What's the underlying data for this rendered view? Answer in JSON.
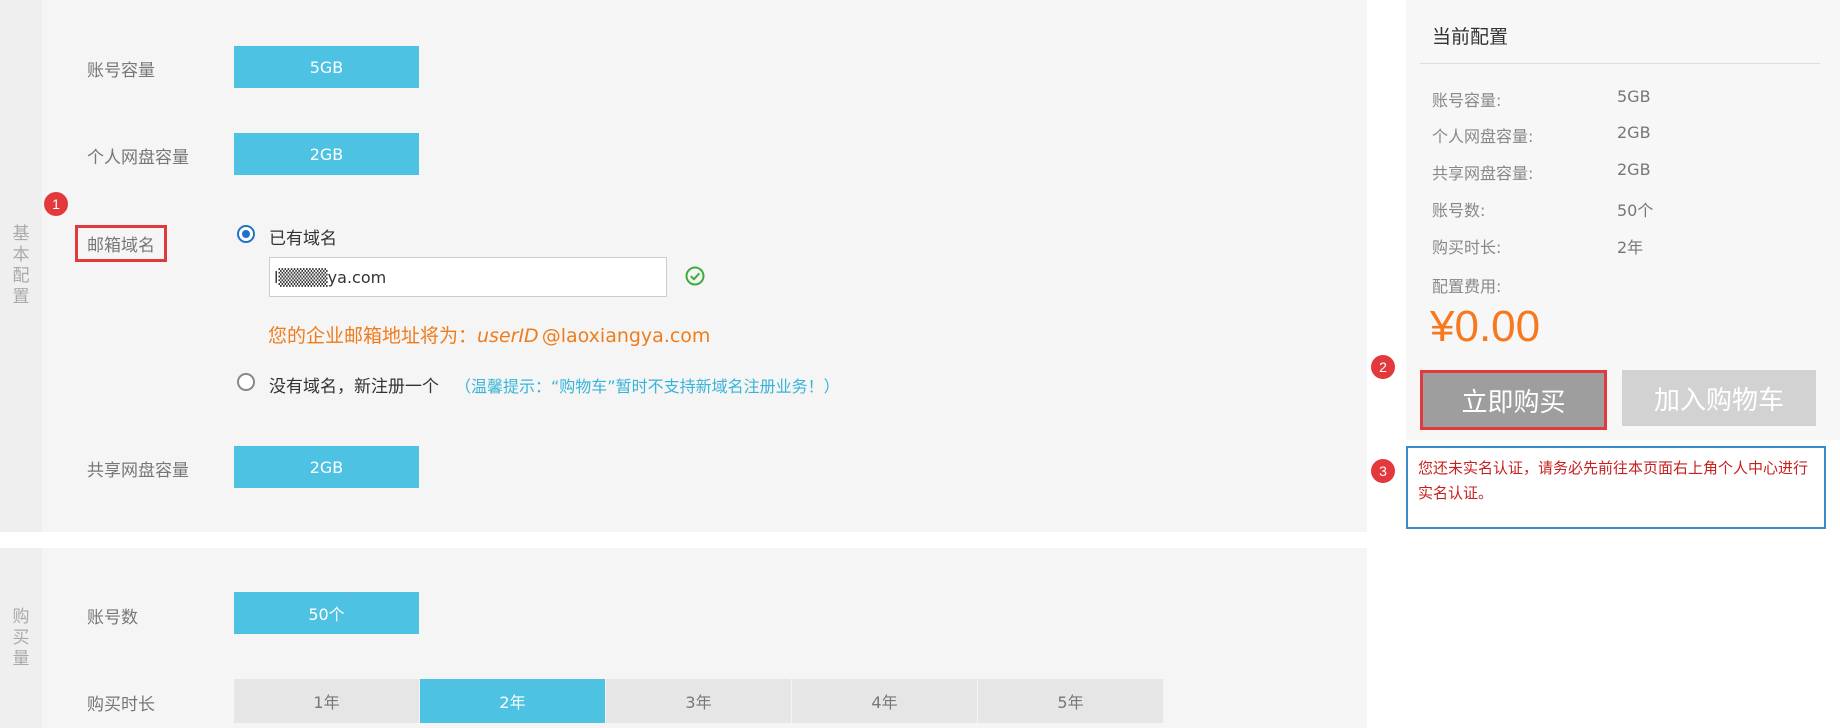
{
  "basic_panel": {
    "side_label": [
      "基",
      "本",
      "配",
      "置"
    ],
    "account_capacity": {
      "label": "账号容量",
      "value": "5GB"
    },
    "personal_disk": {
      "label": "个人网盘容量",
      "value": "2GB"
    },
    "mail_domain": {
      "label": "邮箱域名",
      "badge": "1",
      "option_existing": "已有域名",
      "domain_value": "l▒▒▒▒ya.com",
      "address_prefix": "您的企业邮箱地址将为：",
      "address_user": "userID",
      "address_domain": "@laoxiangya.com",
      "option_new": "没有域名，新注册一个",
      "new_tip": "（温馨提示：“购物车”暂时不支持新域名注册业务！）"
    },
    "shared_disk": {
      "label": "共享网盘容量",
      "value": "2GB"
    }
  },
  "purchase_panel": {
    "side_label": [
      "购",
      "买",
      "量"
    ],
    "account_count": {
      "label": "账号数",
      "value": "50个"
    },
    "duration": {
      "label": "购买时长",
      "options": [
        "1年",
        "2年",
        "3年",
        "4年",
        "5年"
      ],
      "selected": "2年"
    }
  },
  "current_config": {
    "title": "当前配置",
    "rows": [
      {
        "label": "账号容量:",
        "value": "5GB"
      },
      {
        "label": "个人网盘容量:",
        "value": "2GB"
      },
      {
        "label": "共享网盘容量:",
        "value": "2GB"
      },
      {
        "label": "账号数:",
        "value": "50个"
      },
      {
        "label": "购买时长:",
        "value": "2年"
      }
    ],
    "fee_label": "配置费用:",
    "price": "¥0.00",
    "buy_label": "立即购买",
    "cart_label": "加入购物车",
    "badge_buy": "2",
    "badge_warn": "3",
    "warning": "您还未实名认证，请务必先前往本页面右上角个人中心进行实名认证。"
  },
  "colors": {
    "accent_blue": "#4ec2e3",
    "price_orange": "#f7791f",
    "warning_red": "#c81f1f",
    "annotation_red": "#e3393c"
  }
}
